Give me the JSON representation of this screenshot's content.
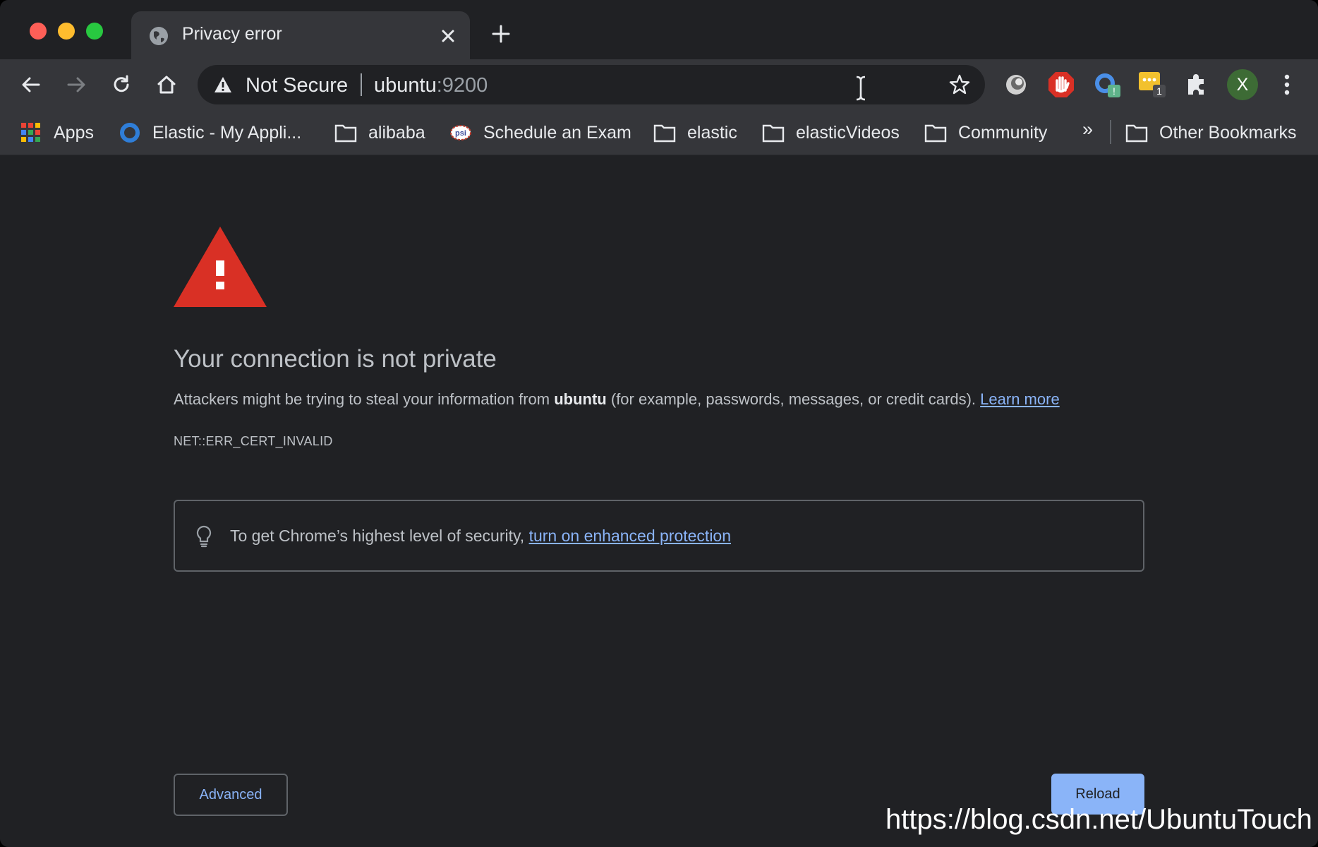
{
  "tab": {
    "title": "Privacy error",
    "favicon": "globe-icon"
  },
  "omnibox": {
    "security_status": "Not Secure",
    "host": "ubuntu",
    "port": ":9200"
  },
  "toolbar": {
    "avatar_letter": "X",
    "badges": [
      "!",
      "1"
    ]
  },
  "bookmarks": {
    "items": [
      {
        "label": "Apps",
        "icon": "apps-grid-icon"
      },
      {
        "label": "Elastic - My Appli...",
        "icon": "elastic-icon"
      },
      {
        "label": "alibaba",
        "icon": "folder-icon"
      },
      {
        "label": "Schedule an Exam",
        "icon": "psi-icon"
      },
      {
        "label": "elastic",
        "icon": "folder-icon"
      },
      {
        "label": "elasticVideos",
        "icon": "folder-icon"
      },
      {
        "label": "Community",
        "icon": "folder-icon"
      }
    ],
    "more": "»",
    "other": "Other Bookmarks"
  },
  "interstitial": {
    "heading": "Your connection is not private",
    "message_before": "Attackers might be trying to steal your information from ",
    "message_host": "ubuntu",
    "message_after": " (for example, passwords, messages, or credit cards). ",
    "learn_more": "Learn more",
    "error_code": "NET::ERR_CERT_INVALID",
    "enhanced_text": "To get Chrome’s highest level of security, ",
    "enhanced_link": "turn on enhanced protection",
    "advanced_label": "Advanced",
    "reload_label": "Reload"
  },
  "watermark": "https://blog.csdn.net/UbuntuTouch",
  "colors": {
    "warning_red": "#d93025",
    "link_blue": "#8ab4f8",
    "background": "#202124"
  }
}
